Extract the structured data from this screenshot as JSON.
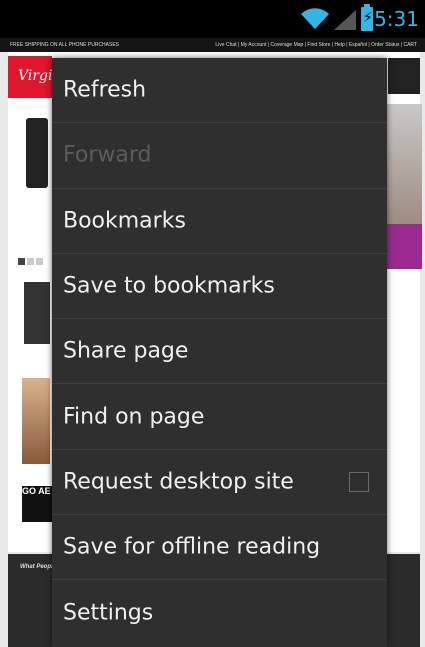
{
  "status_bar": {
    "time": "5:31",
    "icons": [
      "wifi-icon",
      "signal-icon",
      "battery-charging-icon"
    ],
    "accent_color": "#33b5e5"
  },
  "webpage": {
    "top_strip_left": "FREE SHIPPING ON ALL PHONE PURCHASES",
    "top_strip_right": "Live Chat | My Account | Coverage Map | Find Store | Help | Español | Order Status | CART",
    "logo_text": "Virgin",
    "footer_heading": "What People",
    "promo_text": "GO AE"
  },
  "menu": {
    "items": [
      {
        "label": "Refresh",
        "enabled": true
      },
      {
        "label": "Forward",
        "enabled": false
      },
      {
        "label": "Bookmarks",
        "enabled": true
      },
      {
        "label": "Save to bookmarks",
        "enabled": true
      },
      {
        "label": "Share page",
        "enabled": true
      },
      {
        "label": "Find on page",
        "enabled": true
      },
      {
        "label": "Request desktop site",
        "enabled": true,
        "checkbox": false
      },
      {
        "label": "Save for offline reading",
        "enabled": true
      },
      {
        "label": "Settings",
        "enabled": true
      }
    ]
  }
}
